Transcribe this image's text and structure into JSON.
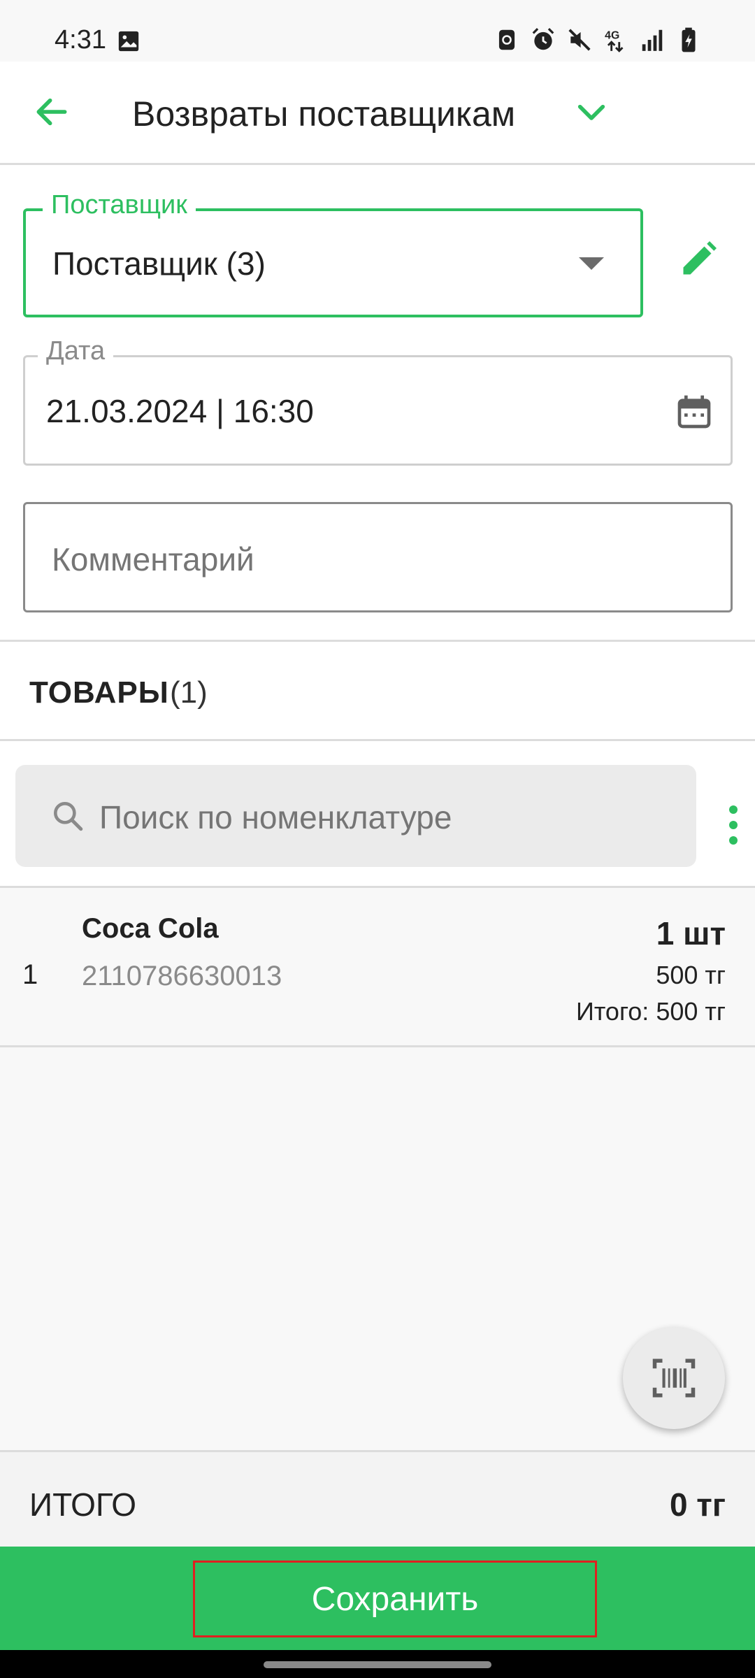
{
  "status_bar": {
    "time": "4:31",
    "icons": [
      "image-icon",
      "nfc-icon",
      "alarm-icon",
      "mute-icon",
      "4g-icon",
      "signal-icon",
      "battery-icon"
    ]
  },
  "app_bar": {
    "title": "Возвраты поставщикам",
    "back_icon": "arrow-left-icon",
    "menu_icon": "chevron-down-icon"
  },
  "form": {
    "supplier": {
      "label": "Поставщик",
      "value": "Поставщик (3)"
    },
    "date": {
      "label": "Дата",
      "value": "21.03.2024 | 16:30"
    },
    "comment": {
      "placeholder": "Комментарий",
      "value": ""
    }
  },
  "goods": {
    "title": "ТОВАРЫ",
    "count": "(1)",
    "search_placeholder": "Поиск по номенклатуре",
    "items": [
      {
        "index": "1",
        "name": "Coca Cola",
        "barcode": "2110786630013",
        "quantity": "1 шт",
        "price": "500 тг",
        "total": "Итого: 500 тг"
      }
    ]
  },
  "totals": {
    "label": "ИТОГО",
    "value": "0 тг"
  },
  "actions": {
    "save_label": "Сохранить"
  },
  "colors": {
    "accent": "#2dbf60",
    "highlight_border": "#e02020",
    "background": "#f8f8f8"
  }
}
